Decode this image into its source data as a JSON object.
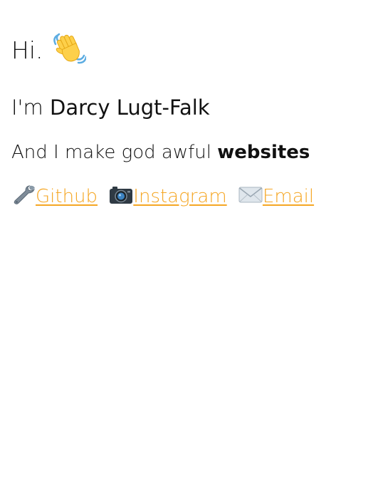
{
  "greeting": {
    "text": "Hi.",
    "icon": "waving-hand-icon"
  },
  "intro": {
    "prefix": "I'm ",
    "name": "Darcy Lugt-Falk"
  },
  "tagline": {
    "prefix": "And I make god awful ",
    "emphasis": "websites"
  },
  "links": [
    {
      "label": "Github",
      "icon": "wrench-icon"
    },
    {
      "label": "Instagram",
      "icon": "camera-icon"
    },
    {
      "label": "Email",
      "icon": "envelope-icon"
    }
  ],
  "colors": {
    "link": "#f5a623",
    "text": "#111111",
    "background": "#ffffff"
  }
}
